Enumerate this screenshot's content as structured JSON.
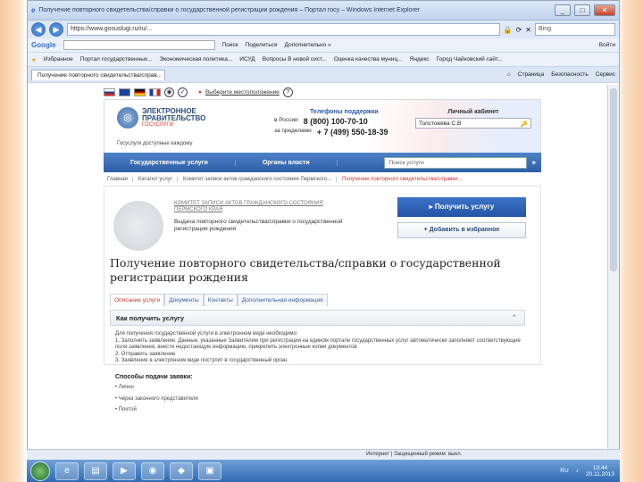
{
  "browser": {
    "title": "Получение повторного свидетельства/справки о государственной регистрации рождения – Портал госу – Windows Internet Explorer",
    "url": "https://www.gosuslugi.ru/ru/...",
    "search_placeholder": "Bing",
    "google_bar": {
      "label": "Google",
      "items": [
        "Поиск",
        "Поделиться",
        "Дополнительно »"
      ],
      "right": "Войти"
    },
    "favorites": {
      "label": "Избранное",
      "items": [
        "Портал государственных...",
        "Экономическая политика...",
        "ИСУД",
        "Вопросы В новой сист...",
        "Оценка качества муниц...",
        "Яндекс",
        "Город Чайковский сайт..."
      ]
    },
    "tab": "Получение повторного свидетельства/справ...",
    "tab_tools": [
      "Страница",
      "Безопасность",
      "Сервис"
    ]
  },
  "site": {
    "lang_location": "Выберите местоположение",
    "logo_line1": "ЭЛЕКТРОННОЕ",
    "logo_line2": "ПРАВИТЕЛЬСТВО",
    "logo_sub": "ГОСУСЛУГИ",
    "gosuslugi_note": "Госуслуги доступные каждому",
    "support_title": "Телефоны поддержки",
    "support_ru_label": "в России",
    "support_ru": "8 (800) 100-70-10",
    "support_abroad_label": "за пределами",
    "support_abroad": "+ 7 (499) 550-18-39",
    "cabinet_title": "Личный кабинет",
    "cabinet_user": "Толстоеева С.В",
    "nav": [
      "Государственные услуги",
      "Органы власти"
    ],
    "nav_search": "Поиск услуги",
    "breadcrumb": [
      "Главная",
      "Каталог услуг",
      "Комитет записи актов гражданского состояния Пермского...",
      "Получение повторного свидетельства/справки..."
    ],
    "agency": "КОМИТЕТ ЗАПИСИ АКТОВ ГРАЖДАНСКОГО СОСТОЯНИЯ ПЕРМСКОГО КРАЯ",
    "service_desc": "Выдача повторного свидетельства/справки о государственной регистрации рождения",
    "get_service": "Получить услугу",
    "add_fav": "Добавить в избранное",
    "service_title": "Получение повторного свидетельства/справки о государственной регистрации рождения",
    "tabs": [
      "Описание услуги",
      "Документы",
      "Контакты",
      "Дополнительная информация"
    ],
    "how_title": "Как получить услугу",
    "details": [
      "Для получения государственной услуги в электронном виде необходимо:",
      "1. Заполнить заявление. Данные, указанные Заявителем при регистрации на едином портале государственных услуг автоматически заполняют соответствующие поля заявления, внести недостающую информацию, прикрепить электронные копии документов",
      "2. Отправить заявление",
      "3. Заявление в электронном виде поступит в государственный орган."
    ],
    "ways_title": "Способы подачи заявки:",
    "ways": [
      "Лично",
      "Через законного представителя",
      "Почтой"
    ]
  },
  "status": "Интернет | Защищенный режим: выкл.",
  "tray": {
    "lang": "RU",
    "time": "13:44",
    "date": "20.11.2013"
  }
}
